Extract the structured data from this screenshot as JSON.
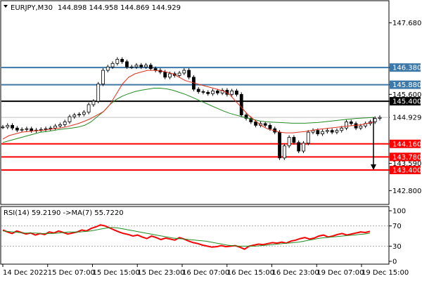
{
  "header": {
    "symbol_timeframe": "EURJPY,M30",
    "ohlc": "144.898 144.958 144.869 144.929"
  },
  "chart_data": [
    {
      "type": "candlestick",
      "panel": "price",
      "title": "EURJPY,M30",
      "open": 144.898,
      "high": 144.958,
      "low": 144.869,
      "close": 144.929,
      "ylim": [
        142.5,
        148.1
      ],
      "y_ticks": [
        {
          "value": 147.68,
          "label": "147.680"
        },
        {
          "value": 146.38,
          "label": "146.380"
        },
        {
          "value": 145.88,
          "label": "145.880"
        },
        {
          "value": 145.6,
          "label": "145.600"
        },
        {
          "value": 145.4,
          "label": "145.400"
        },
        {
          "value": 144.929,
          "label": "144.929"
        },
        {
          "value": 144.16,
          "label": "144.160"
        },
        {
          "value": 143.78,
          "label": "143.780"
        },
        {
          "value": 143.59,
          "label": "143.590"
        },
        {
          "value": 143.4,
          "label": "143.400"
        },
        {
          "value": 142.8,
          "label": "142.800"
        }
      ],
      "level_lines": [
        {
          "value": 146.38,
          "label": "146.380",
          "color": "#3c78a8",
          "style": "resistance"
        },
        {
          "value": 145.88,
          "label": "145.880",
          "color": "#3c78a8",
          "style": "resistance"
        },
        {
          "value": 145.4,
          "label": "145.400",
          "color": "#000000",
          "style": "pivot"
        },
        {
          "value": 144.16,
          "label": "144.160",
          "color": "#ff0000",
          "style": "support"
        },
        {
          "value": 143.78,
          "label": "143.780",
          "color": "#ff0000",
          "style": "support"
        },
        {
          "value": 143.4,
          "label": "143.400",
          "color": "#ff0000",
          "style": "support"
        }
      ],
      "current_price": {
        "value": 144.929,
        "label": "144.929",
        "color": "#c0c0c0"
      },
      "arrow": {
        "from_value": 144.929,
        "to_value": 143.4,
        "direction": "down",
        "color": "#000000"
      },
      "close_path": [
        144.65,
        144.7,
        144.62,
        144.56,
        144.58,
        144.6,
        144.54,
        144.56,
        144.58,
        144.6,
        144.62,
        144.68,
        144.72,
        144.8,
        144.95,
        145.0,
        145.02,
        145.08,
        145.3,
        145.4,
        145.9,
        146.3,
        146.4,
        146.5,
        146.62,
        146.55,
        146.4,
        146.4,
        146.45,
        146.4,
        146.45,
        146.35,
        146.3,
        146.25,
        146.1,
        146.2,
        146.15,
        146.22,
        146.3,
        146.1,
        145.75,
        145.68,
        145.66,
        145.62,
        145.7,
        145.64,
        145.72,
        145.6,
        145.7,
        145.6,
        145.0,
        144.9,
        144.8,
        144.7,
        144.75,
        144.7,
        144.6,
        144.5,
        143.75,
        144.1,
        144.35,
        144.2,
        143.95,
        144.18,
        144.5,
        144.55,
        144.45,
        144.52,
        144.55,
        144.5,
        144.55,
        144.62,
        144.8,
        144.75,
        144.62,
        144.68,
        144.75,
        144.8,
        144.9,
        144.929
      ],
      "ma_fast": [
        144.3,
        144.4,
        144.45,
        144.5,
        144.52,
        144.54,
        144.55,
        144.57,
        144.6,
        144.62,
        144.65,
        144.7,
        144.75,
        144.82,
        144.9,
        145.0,
        145.1,
        145.3,
        145.6,
        145.9,
        146.1,
        146.2,
        146.25,
        146.3,
        146.3,
        146.28,
        146.25,
        146.2,
        146.1,
        146.0,
        145.95,
        145.9,
        145.85,
        145.8,
        145.75,
        145.7,
        145.6,
        145.4,
        145.2,
        145.0,
        144.85,
        144.7,
        144.6,
        144.55,
        144.5,
        144.48,
        144.48,
        144.5,
        144.52,
        144.55,
        144.58,
        144.6,
        144.62,
        144.64,
        144.66,
        144.68,
        144.7,
        144.72,
        144.76,
        144.8
      ],
      "ma_slow": [
        144.2,
        144.25,
        144.3,
        144.35,
        144.4,
        144.45,
        144.5,
        144.52,
        144.55,
        144.58,
        144.6,
        144.62,
        144.65,
        144.7,
        144.8,
        144.95,
        145.1,
        145.3,
        145.45,
        145.55,
        145.62,
        145.68,
        145.72,
        145.75,
        145.78,
        145.78,
        145.76,
        145.72,
        145.66,
        145.6,
        145.52,
        145.44,
        145.36,
        145.28,
        145.2,
        145.12,
        145.05,
        145.0,
        144.95,
        144.9,
        144.86,
        144.82,
        144.8,
        144.79,
        144.78,
        144.77,
        144.76,
        144.76,
        144.76,
        144.77,
        144.78,
        144.8,
        144.82,
        144.84,
        144.86,
        144.88,
        144.9,
        144.91,
        144.92,
        144.93
      ],
      "colors": {
        "close_path": "#000000",
        "ma_fast": "#e0301e",
        "ma_slow": "#228b22",
        "grid": "#e8e8e8"
      }
    },
    {
      "type": "line",
      "panel": "oscillator",
      "title": "RSI(14) 59.2190 ->MA(7) 55.7220",
      "ylim": [
        0,
        100
      ],
      "y_ticks": [
        {
          "value": 100,
          "label": "100"
        },
        {
          "value": 70,
          "label": "70"
        },
        {
          "value": 30,
          "label": "30"
        },
        {
          "value": 0,
          "label": "0"
        }
      ],
      "series": [
        {
          "name": "RSI(14)",
          "color": "#ff0000",
          "values": [
            62,
            58,
            55,
            60,
            57,
            54,
            56,
            52,
            55,
            53,
            58,
            56,
            60,
            57,
            54,
            56,
            58,
            62,
            60,
            65,
            68,
            72,
            70,
            66,
            62,
            58,
            55,
            53,
            50,
            52,
            48,
            45,
            50,
            47,
            43,
            46,
            44,
            42,
            47,
            44,
            40,
            37,
            35,
            32,
            30,
            28,
            29,
            31,
            29,
            30,
            31,
            28,
            24,
            30,
            32,
            34,
            33,
            35,
            37,
            36,
            38,
            36,
            40,
            42,
            45,
            47,
            44,
            46,
            50,
            52,
            48,
            50,
            53,
            55,
            52,
            54,
            56,
            58,
            57,
            59.219
          ]
        },
        {
          "name": "MA(7)",
          "color": "#228b22",
          "values": [
            60,
            59,
            58,
            57,
            56,
            56,
            56,
            55,
            55,
            55,
            56,
            57,
            58,
            58,
            58,
            59,
            60,
            62,
            64,
            66,
            67,
            66,
            64,
            62,
            60,
            58,
            56,
            54,
            52,
            50,
            48,
            46,
            45,
            44,
            43,
            42,
            41,
            40,
            38,
            36,
            34,
            32,
            31,
            30,
            30,
            30,
            30,
            31,
            32,
            33,
            34,
            35,
            36,
            37,
            38,
            40,
            42,
            44,
            46,
            47,
            48,
            49,
            50,
            51,
            52,
            53,
            54,
            55.722
          ]
        }
      ],
      "levels": [
        70,
        30
      ]
    }
  ],
  "x_axis": {
    "tick_labels": [
      "14 Dec 2022",
      "15 Dec 07:00",
      "15 Dec 15:00",
      "15 Dec 23:00",
      "16 Dec 07:00",
      "16 Dec 15:00",
      "16 Dec 23:00",
      "19 Dec 07:00",
      "19 Dec 15:00"
    ]
  }
}
